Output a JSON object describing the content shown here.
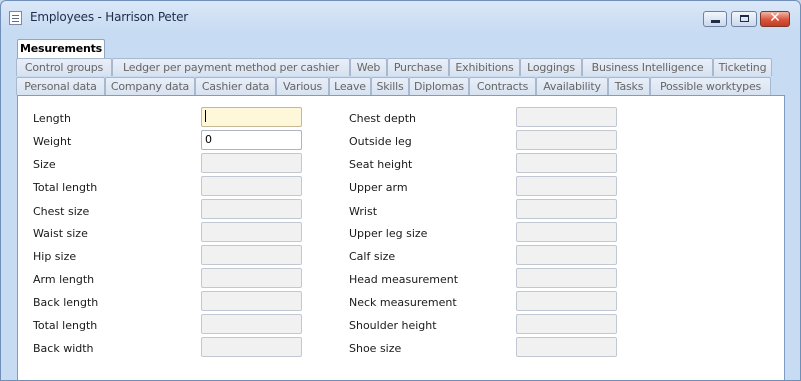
{
  "window": {
    "title": "Employees - Harrison Peter"
  },
  "tabs": {
    "row1": [
      "Mesurements"
    ],
    "row2": [
      "Control groups",
      "Ledger per payment method per cashier",
      "Web",
      "Purchase",
      "Exhibitions",
      "Loggings",
      "Business Intelligence",
      "Ticketing"
    ],
    "row3": [
      "Personal data",
      "Company data",
      "Cashier data",
      "Various",
      "Leave",
      "Skills",
      "Diplomas",
      "Contracts",
      "Availability",
      "Tasks",
      "Possible worktypes"
    ],
    "active": "Mesurements"
  },
  "form": {
    "left": [
      {
        "label": "Length",
        "value": ""
      },
      {
        "label": "Weight",
        "value": "0"
      },
      {
        "label": "Size",
        "value": ""
      },
      {
        "label": "Total length",
        "value": ""
      },
      {
        "label": "Chest size",
        "value": ""
      },
      {
        "label": "Waist size",
        "value": ""
      },
      {
        "label": "Hip size",
        "value": ""
      },
      {
        "label": "Arm length",
        "value": ""
      },
      {
        "label": "Back length",
        "value": ""
      },
      {
        "label": "Total length",
        "value": ""
      },
      {
        "label": "Back width",
        "value": ""
      }
    ],
    "right": [
      {
        "label": "Chest depth",
        "value": ""
      },
      {
        "label": "Outside leg",
        "value": ""
      },
      {
        "label": "Seat height",
        "value": ""
      },
      {
        "label": "Upper arm",
        "value": ""
      },
      {
        "label": "Wrist",
        "value": ""
      },
      {
        "label": "Upper leg size",
        "value": ""
      },
      {
        "label": "Calf size",
        "value": ""
      },
      {
        "label": "Head measurement",
        "value": ""
      },
      {
        "label": "Neck measurement",
        "value": ""
      },
      {
        "label": "Shoulder height",
        "value": ""
      },
      {
        "label": "Shoe size",
        "value": ""
      }
    ]
  },
  "colors": {
    "focused_field": "#fff7da",
    "disabled_field": "#f1f1f1",
    "panel_border": "#7f9dc4",
    "window_bg": "#c7dbf2"
  },
  "icons": {
    "app": "document-list-icon",
    "minimize": "minimize-icon",
    "maximize": "maximize-icon",
    "close": "close-icon"
  }
}
